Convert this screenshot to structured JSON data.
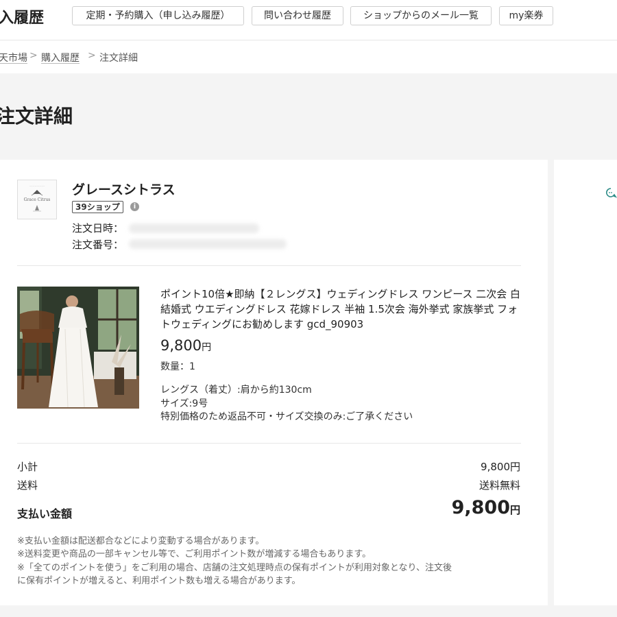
{
  "header": {
    "title": "入履歴",
    "nav": [
      "定期・予約購入（申し込み履歴）",
      "問い合わせ履歴",
      "ショップからのメール一覧",
      "my楽券"
    ]
  },
  "breadcrumb": {
    "items": [
      "天市場",
      "購入履歴",
      "注文詳細"
    ],
    "separator": ">"
  },
  "page": {
    "title": "注文詳細"
  },
  "shop": {
    "logo_text": "Grace Citrus",
    "name": "グレースシトラス",
    "badge": "39ショップ",
    "order_date_label": "注文日時：",
    "order_number_label": "注文番号："
  },
  "product": {
    "name": "ポイント10倍★即納【２レングス】ウェディングドレス ワンピース 二次会 白 結婚式 ウエディングドレス 花嫁ドレス 半袖 1.5次会 海外挙式 家族挙式 フォトウェディングにお勧めします gcd_90903",
    "price": "9,800",
    "price_unit": "円",
    "quantity": "数量：1",
    "option_length": "レングス（着丈）:肩から約130cm",
    "option_size": "サイズ:9号",
    "option_note": "特別価格のため返品不可・サイズ交換のみ:ご了承ください"
  },
  "summary": {
    "subtotal_label": "小計",
    "subtotal_value": "9,800円",
    "shipping_label": "送料",
    "shipping_value": "送料無料",
    "total_label": "支払い金額",
    "total_value": "9,800",
    "total_unit": "円"
  },
  "notes": [
    "※支払い金額は配送都合などにより変動する場合があります。",
    "※送料変更や商品の一部キャンセル等で、ご利用ポイント数が増減する場合もあります。",
    "※「全てのポイントを使う」をご利用の場合、店舗の注文処理時点の保有ポイントが利用対象となり、注文後",
    "に保有ポイントが増えると、利用ポイント数も増える場合があります。"
  ],
  "icons": {
    "info": "info-icon",
    "side": "chat-icon"
  }
}
